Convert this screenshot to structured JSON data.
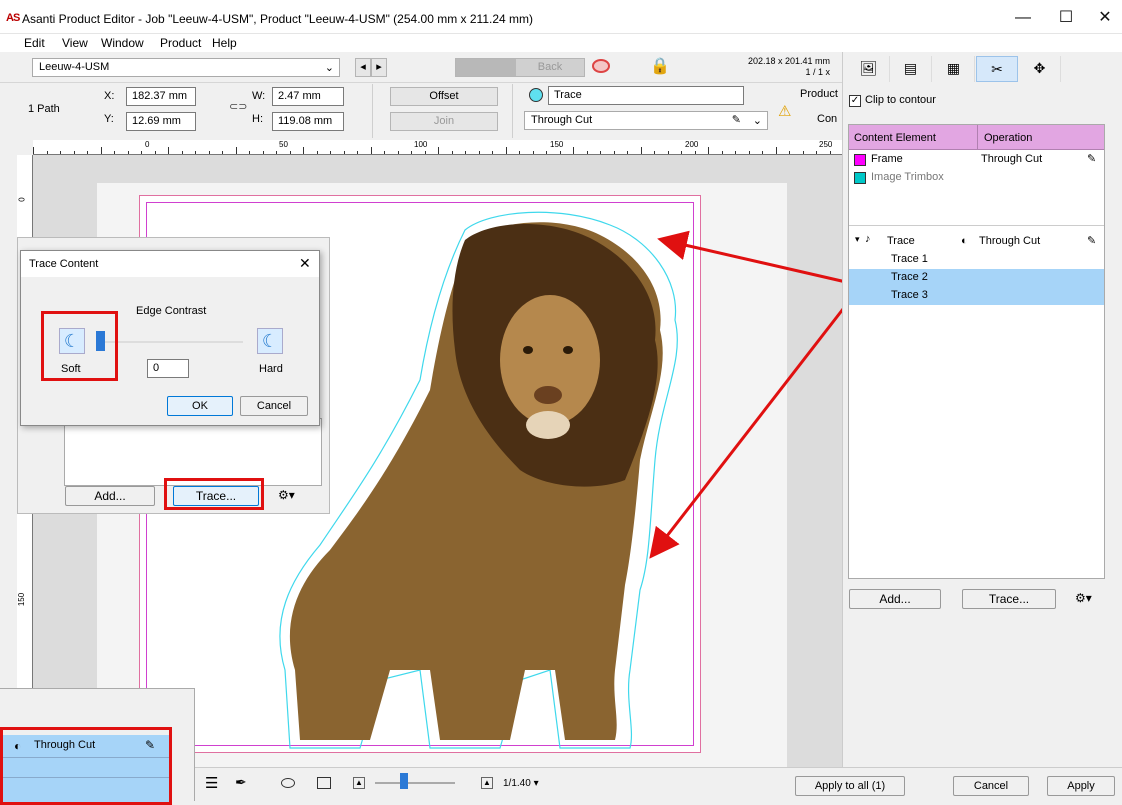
{
  "window": {
    "logo": "AS",
    "title": "Asanti Product Editor - Job \"Leeuw-4-USM\", Product \"Leeuw-4-USM\" (254.00 mm x 211.24 mm)",
    "minimize": "—",
    "maximize": "☐",
    "close": "✕"
  },
  "menu": [
    "Edit",
    "View",
    "Window",
    "Product",
    "Help"
  ],
  "toolbar": {
    "job_select": "Leeuw-4-USM",
    "nav_back": "◂",
    "nav_forward": "▸",
    "back_label": "Back",
    "dimensions": "202.18 x 201.41 mm",
    "scale": "1 / 1 x",
    "selection_info": "1 Path",
    "x_label": "X:",
    "x_value": "182.37 mm",
    "y_label": "Y:",
    "y_value": "12.69 mm",
    "w_label": "W:",
    "w_value": "2.47 mm",
    "h_label": "H:",
    "h_value": "119.08 mm",
    "offset_label": "Offset",
    "join_label": "Join",
    "trace_name": "Trace",
    "operation": "Through Cut",
    "warning_line1": "Product",
    "warning_line2": "Con"
  },
  "ruler": {
    "h_labels": [
      "0",
      "50",
      "100",
      "150",
      "200",
      "250"
    ],
    "v_labels": [
      "0",
      "150"
    ]
  },
  "right_panel": {
    "clip_label": "Clip to contour",
    "col_element": "Content Element",
    "col_operation": "Operation",
    "rows": [
      {
        "name": "Frame",
        "op": "Through Cut",
        "color": "#ff00ff"
      },
      {
        "name": "Image Trimbox",
        "op": "",
        "color": "#00c8c8"
      }
    ],
    "trace_group": {
      "name": "Trace",
      "op": "Through Cut"
    },
    "trace_items": [
      "Trace 1",
      "Trace 2",
      "Trace 3"
    ],
    "add_label": "Add...",
    "trace_label": "Trace...",
    "gear": "⚙▾"
  },
  "dialog": {
    "title": "Trace Content",
    "close": "✕",
    "heading": "Edge Contrast",
    "soft_label": "Soft",
    "hard_label": "Hard",
    "value": "0",
    "ok_label": "OK",
    "cancel_label": "Cancel"
  },
  "behind_panel": {
    "add_label": "Add...",
    "trace_label": "Trace...",
    "gear": "⚙▾"
  },
  "zoom_snippet": {
    "op": "Through Cut"
  },
  "bottom": {
    "zoom": "1/1.40 ▾",
    "apply_all": "Apply to all (1)",
    "cancel": "Cancel",
    "apply": "Apply"
  }
}
